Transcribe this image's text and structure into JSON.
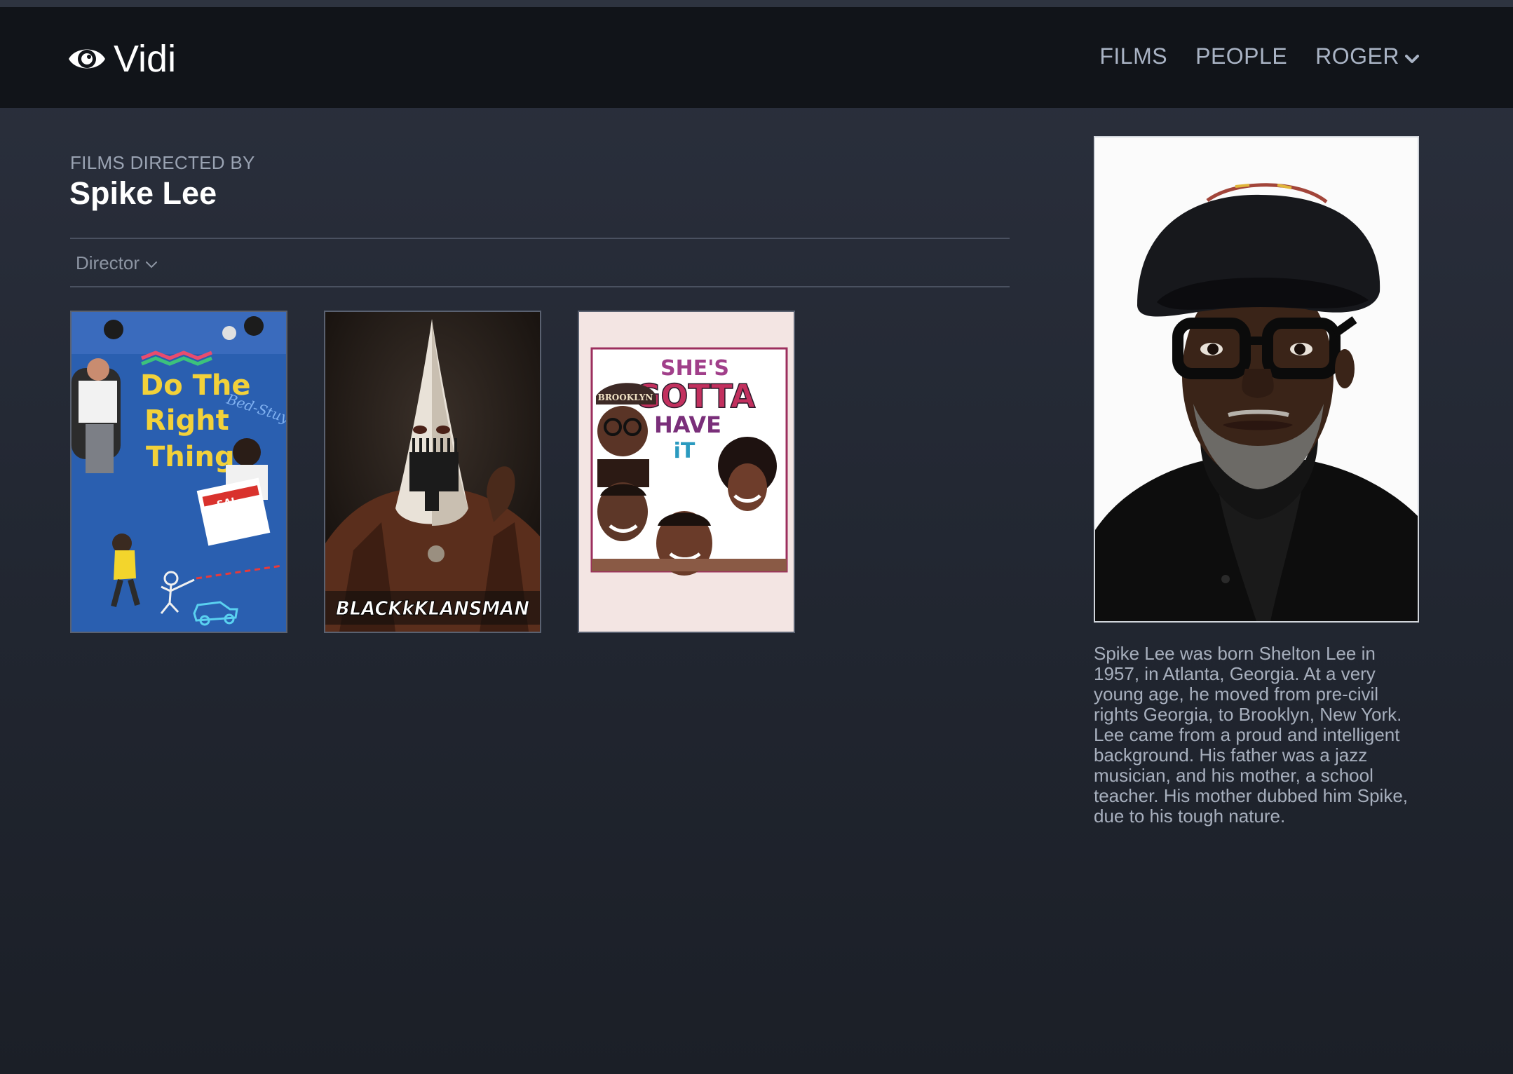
{
  "app": {
    "name": "Vidi",
    "logo_icon": "eye-icon"
  },
  "nav": {
    "films": "FILMS",
    "people": "PEOPLE",
    "user": "ROGER",
    "user_menu_icon": "chevron-down-icon"
  },
  "page": {
    "subtitle": "FILMS DIRECTED BY",
    "title": "Spike Lee"
  },
  "filter": {
    "label": "Director",
    "icon": "chevron-down-icon"
  },
  "films": [
    {
      "poster_text": [
        "Do The",
        "Right",
        "Thing"
      ],
      "poster_tag": "Bed-Stuy",
      "pizza_label": "SAL"
    },
    {
      "poster_text": [
        "BLACKkKLANSMAN"
      ]
    },
    {
      "poster_text": [
        "SHE'S",
        "GOTTA",
        "HAVE",
        "iT"
      ],
      "cap_text": "BROOKLYN"
    }
  ],
  "person": {
    "bio": "Spike Lee was born Shelton Lee in 1957, in Atlanta, Georgia. At a very young age, he moved from pre-civil rights Georgia, to Brooklyn, New York. Lee came from a proud and intelligent background. His father was a jazz musician, and his mother, a school teacher. His mother dubbed him Spike, due to his tough nature."
  },
  "colors": {
    "nav_bg": "#111419",
    "page_bg_top": "#2b303d",
    "page_bg_bottom": "#1b1f27",
    "nav_text": "#a9b3c4",
    "muted_text": "#9aa3b3",
    "rule": "#4a5160"
  }
}
